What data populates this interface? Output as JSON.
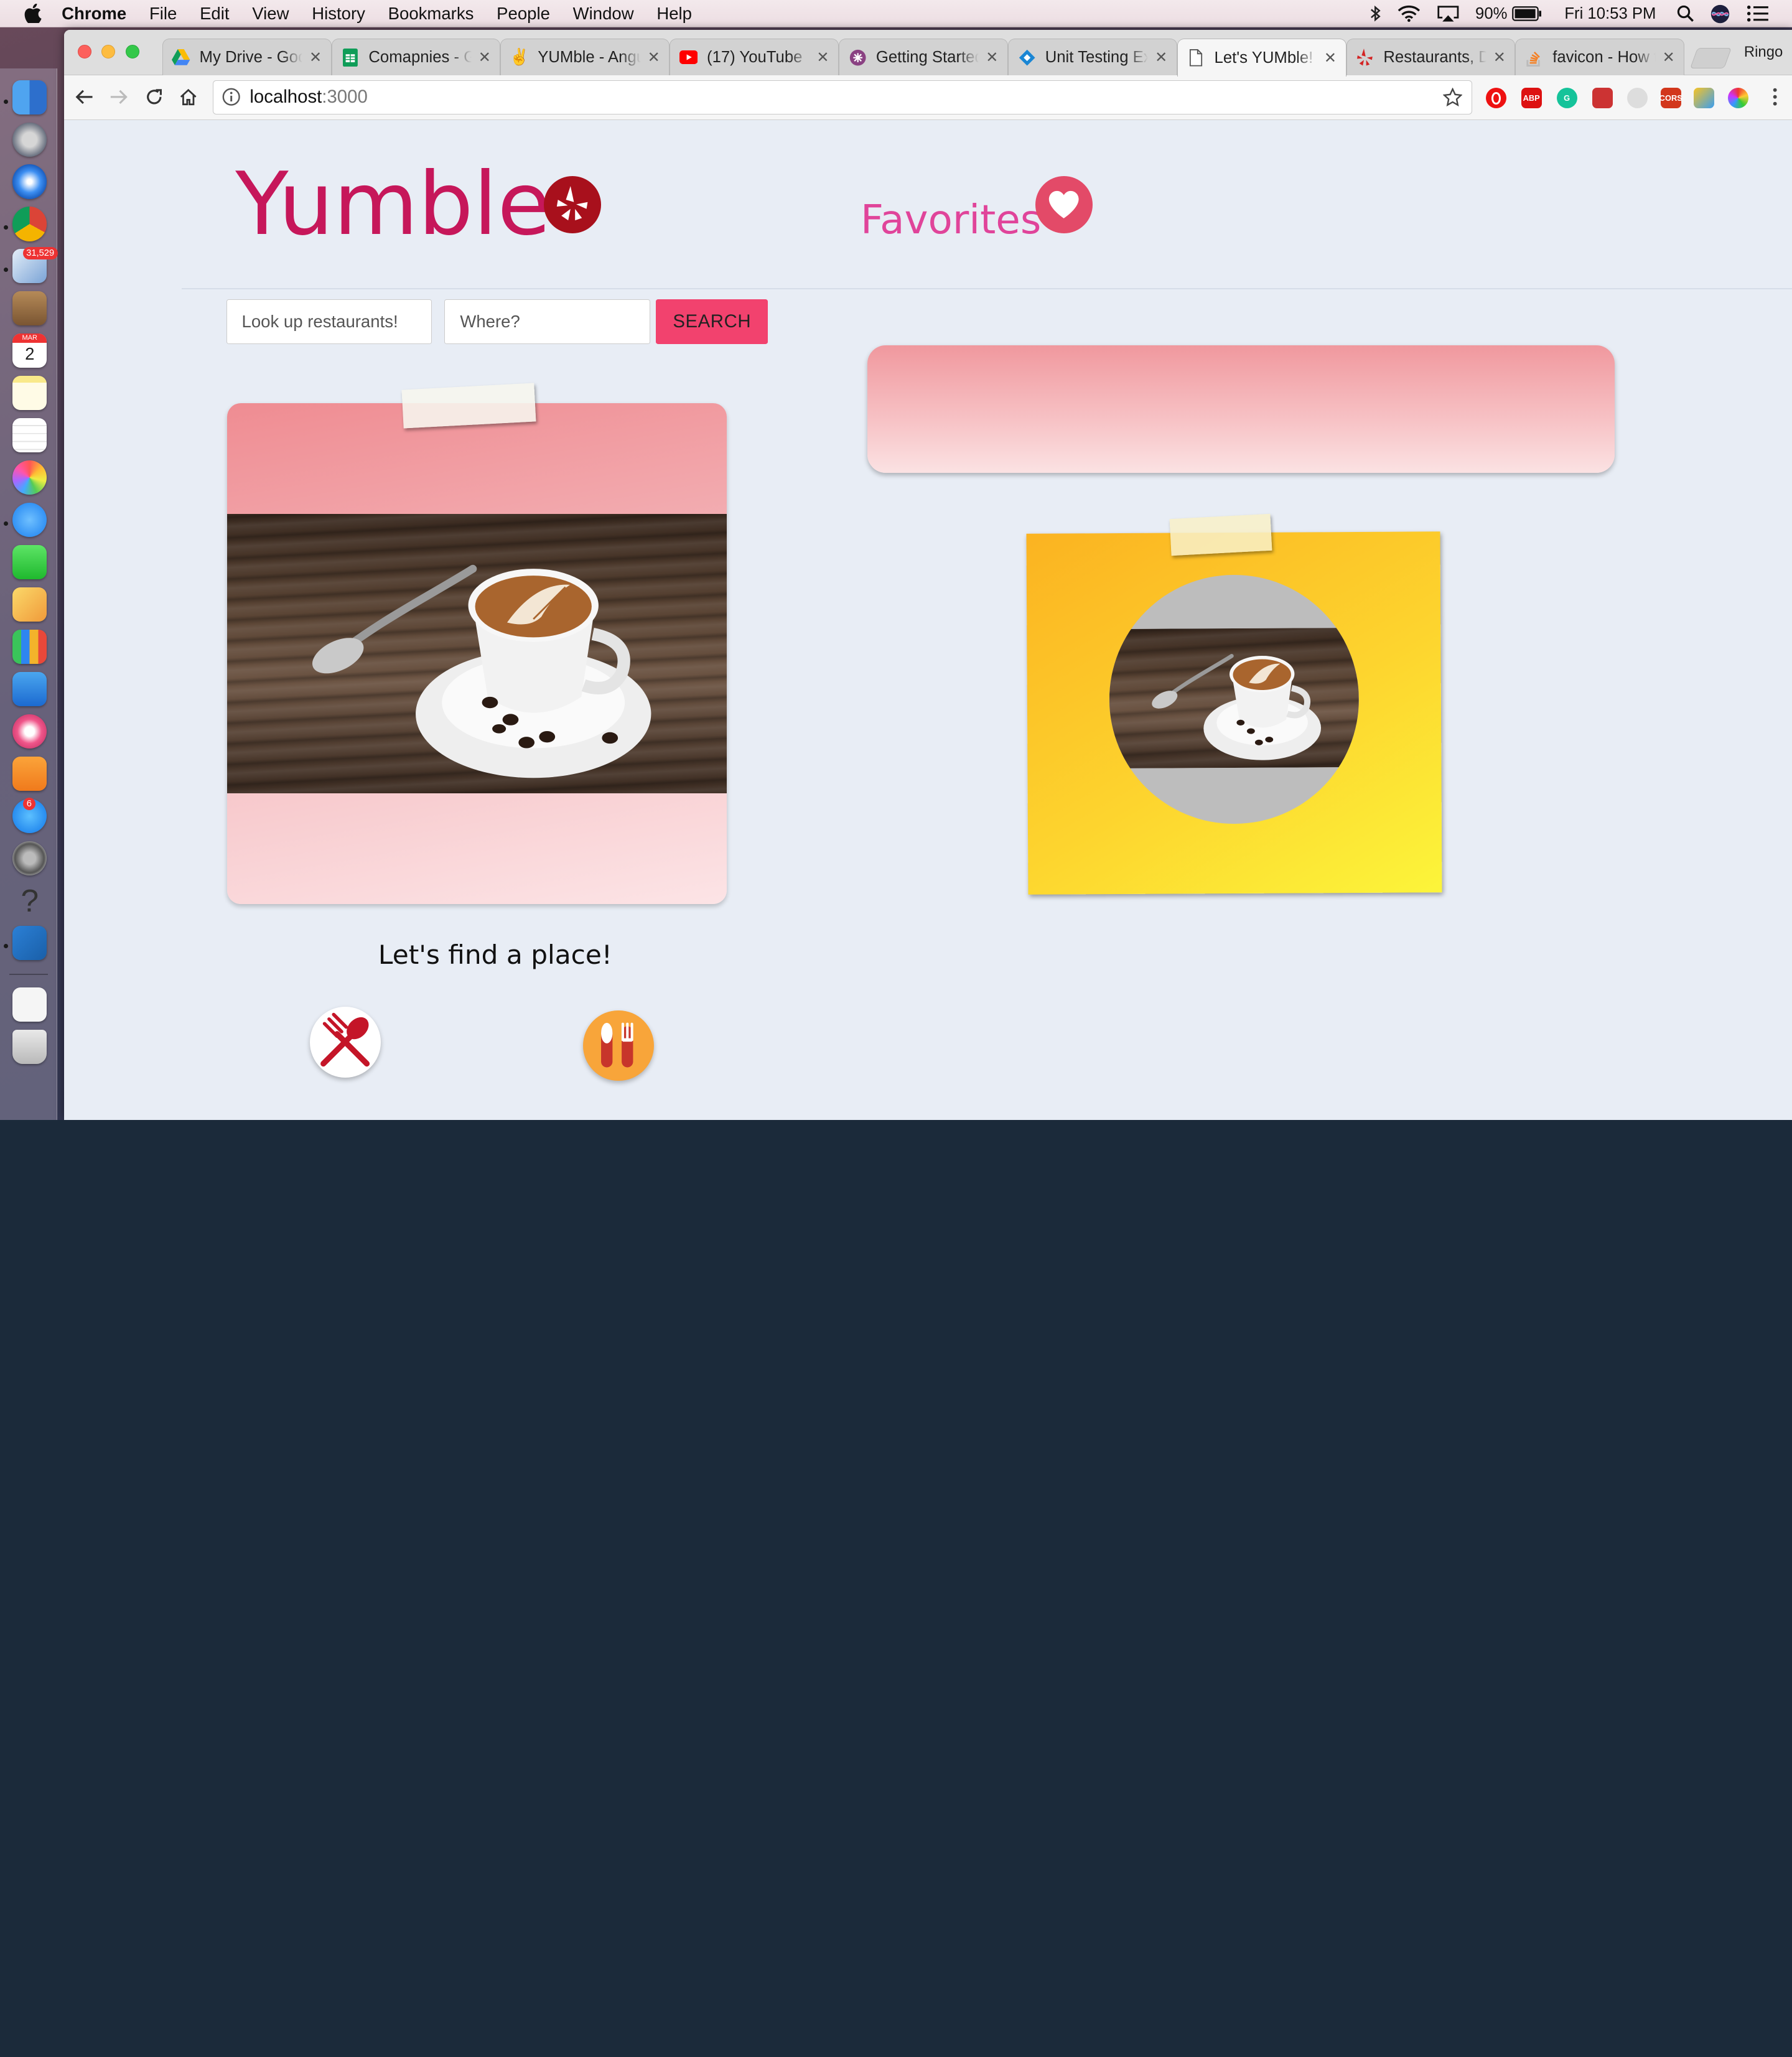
{
  "menubar": {
    "app": "Chrome",
    "items": [
      "File",
      "Edit",
      "View",
      "History",
      "Bookmarks",
      "People",
      "Window",
      "Help"
    ],
    "battery": "90%",
    "clock": "Fri 10:53 PM"
  },
  "dock": {
    "mail_badge": "31,529",
    "calendar_month": "MAR",
    "calendar_day": "2",
    "appstore_badge": "6"
  },
  "browser": {
    "tabs": [
      {
        "title": "My Drive - Google Drive",
        "icon": "google-drive-icon"
      },
      {
        "title": "Comapnies - Google Sheets",
        "icon": "google-sheets-icon"
      },
      {
        "title": "YUMble - Angular",
        "icon": "peace-hand-icon"
      },
      {
        "title": "(17) YouTube",
        "icon": "youtube-icon"
      },
      {
        "title": "Getting Started",
        "icon": "jasmine-icon"
      },
      {
        "title": "Unit Testing Example",
        "icon": "diamond-icon"
      },
      {
        "title": "Let's YUMble!",
        "icon": "document-icon"
      },
      {
        "title": "Restaurants, Dentists",
        "icon": "yelp-icon"
      },
      {
        "title": "favicon - How to",
        "icon": "stackoverflow-icon"
      }
    ],
    "profile": "Ringo",
    "url_host": "localhost",
    "url_port": ":3000"
  },
  "page": {
    "title": "Yumble",
    "favorites_label": "Favorites",
    "search": {
      "term_placeholder": "Look up restaurants!",
      "location_placeholder": "Where?",
      "button": "SEARCH"
    },
    "tagline": "Let's find a place!"
  },
  "colors": {
    "brand": "#c6175a",
    "favorites": "#e0449a",
    "search_button": "#f2426e",
    "yelp_red": "#a8101c"
  }
}
